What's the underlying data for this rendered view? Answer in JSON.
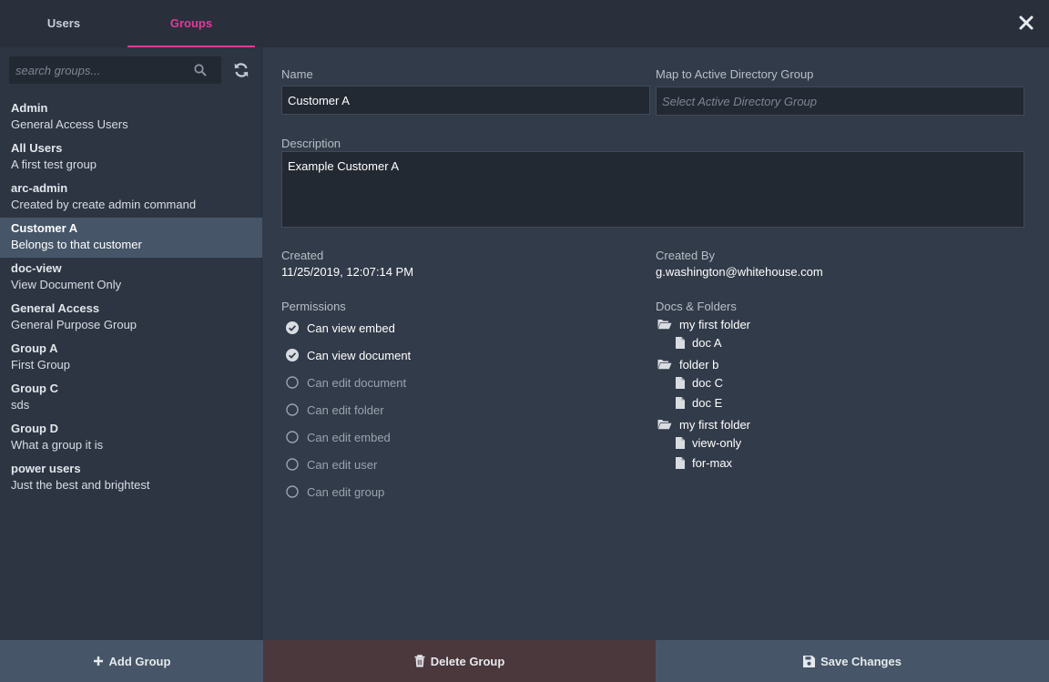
{
  "tabs": {
    "users": "Users",
    "groups": "Groups"
  },
  "search": {
    "placeholder": "search groups..."
  },
  "groups": [
    {
      "name": "Admin",
      "description": "General Access Users"
    },
    {
      "name": "All Users",
      "description": "A first test group"
    },
    {
      "name": "arc-admin",
      "description": "Created by create admin command"
    },
    {
      "name": "Customer A",
      "description": "Belongs to that customer"
    },
    {
      "name": "doc-view",
      "description": "View Document Only"
    },
    {
      "name": "General Access",
      "description": "General Purpose Group"
    },
    {
      "name": "Group A",
      "description": "First Group"
    },
    {
      "name": "Group C",
      "description": "sds"
    },
    {
      "name": "Group D",
      "description": "What a group it is"
    },
    {
      "name": "power users",
      "description": "Just the best and brightest"
    }
  ],
  "form": {
    "name_label": "Name",
    "name_value": "Customer A",
    "ad_label": "Map to Active Directory Group",
    "ad_placeholder": "Select Active Directory Group",
    "description_label": "Description",
    "description_value": "Example Customer A",
    "created_label": "Created",
    "created_value": "11/25/2019, 12:07:14 PM",
    "created_by_label": "Created By",
    "created_by_value": "g.washington@whitehouse.com",
    "permissions_label": "Permissions",
    "docs_label": "Docs & Folders"
  },
  "permissions": [
    {
      "label": "Can view embed",
      "checked": true
    },
    {
      "label": "Can view document",
      "checked": true
    },
    {
      "label": "Can edit document",
      "checked": false
    },
    {
      "label": "Can edit folder",
      "checked": false
    },
    {
      "label": "Can edit embed",
      "checked": false
    },
    {
      "label": "Can edit user",
      "checked": false
    },
    {
      "label": "Can edit group",
      "checked": false
    }
  ],
  "tree": [
    {
      "type": "folder",
      "label": "my first folder"
    },
    {
      "type": "doc",
      "label": "doc A"
    },
    {
      "type": "folder",
      "label": "folder b"
    },
    {
      "type": "doc",
      "label": "doc C"
    },
    {
      "type": "doc",
      "label": "doc E"
    },
    {
      "type": "folder",
      "label": "my first folder"
    },
    {
      "type": "doc",
      "label": "view-only"
    },
    {
      "type": "doc",
      "label": "for-max"
    }
  ],
  "buttons": {
    "add": "Add Group",
    "delete": "Delete Group",
    "save": "Save Changes"
  },
  "colors": {
    "accent": "#e5389a",
    "selected_row": "#465668",
    "delete": "#4a383d"
  }
}
